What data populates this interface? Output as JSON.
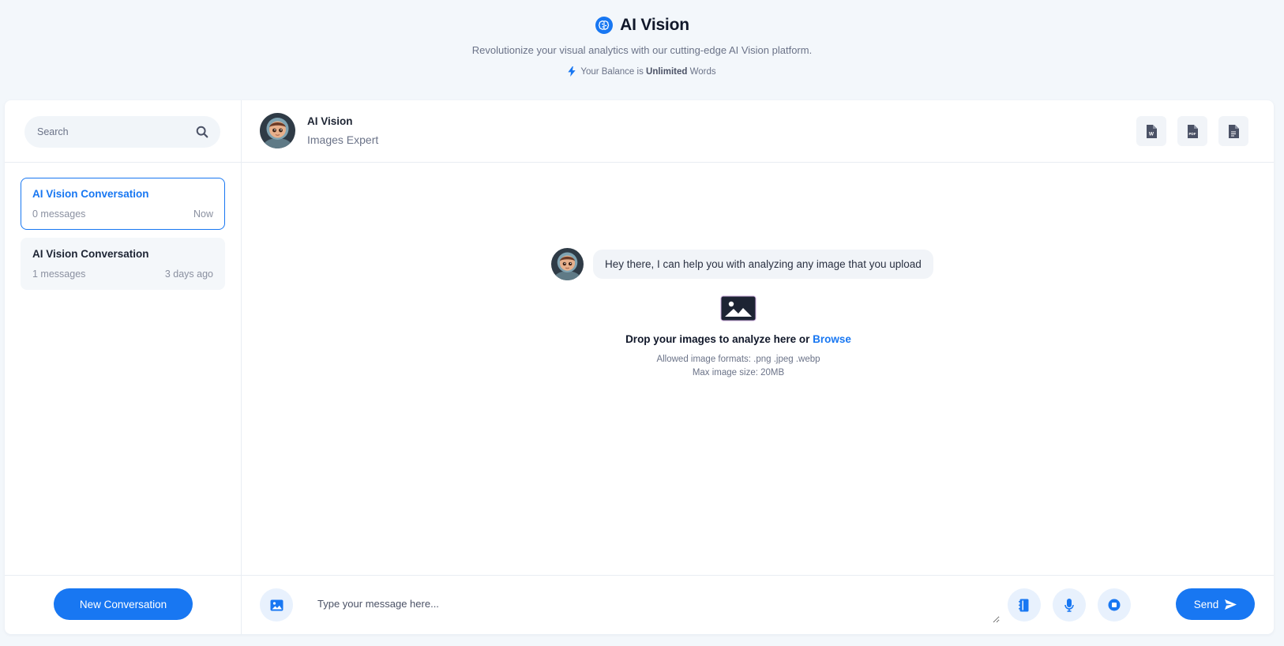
{
  "header": {
    "title": "AI Vision",
    "subtitle": "Revolutionize your visual analytics with our cutting-edge AI Vision platform.",
    "balance_prefix": "Your Balance is",
    "balance_value": "Unlimited",
    "balance_suffix": "Words"
  },
  "sidebar": {
    "search_placeholder": "Search",
    "conversations": [
      {
        "title": "AI Vision Conversation",
        "messages": "0 messages",
        "time": "Now",
        "active": true
      },
      {
        "title": "AI Vision Conversation",
        "messages": "1 messages",
        "time": "3 days ago",
        "active": false
      }
    ],
    "new_conversation_label": "New Conversation"
  },
  "chat": {
    "assistant_name": "AI Vision",
    "assistant_role": "Images Expert",
    "welcome_message": "Hey there, I can help you with analyzing any image that you upload",
    "drop_text": "Drop your images to analyze here or",
    "browse_label": "Browse",
    "formats_text": "Allowed image formats: .png .jpeg .webp",
    "size_text": "Max image size: 20MB",
    "input_placeholder": "Type your message here...",
    "send_label": "Send"
  },
  "icons": {
    "brand": "brain-icon",
    "balance": "lightning-icon",
    "search": "search-icon",
    "export_word": "word-file-icon",
    "export_pdf": "pdf-file-icon",
    "export_text": "text-file-icon",
    "attach": "image-icon",
    "upload": "image-upload-icon",
    "prompt_library": "notebook-icon",
    "voice": "microphone-icon",
    "stop": "stop-icon",
    "send": "paper-plane-icon"
  },
  "colors": {
    "accent": "#1877f2",
    "background": "#f3f7fb",
    "text": "#1d2433",
    "muted": "#6b7388"
  }
}
